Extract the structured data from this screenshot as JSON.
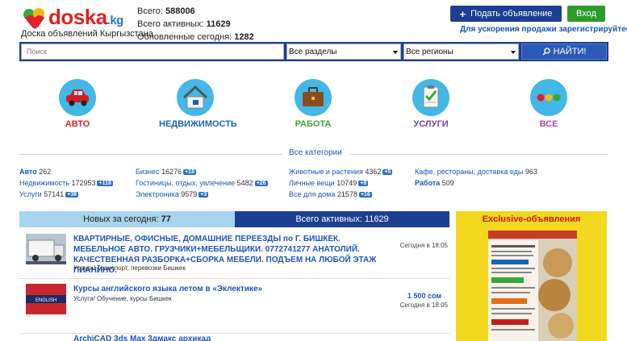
{
  "header": {
    "logo_main": "doska",
    "logo_tld": ".kg",
    "tagline": "Доска объявлений Кыргызстана",
    "stats": [
      {
        "label": "Всего:",
        "value": "588006"
      },
      {
        "label": "Всего активных:",
        "value": "11629"
      },
      {
        "label": "Обновленные сегодня:",
        "value": "1282"
      }
    ],
    "add_button": "Подать объявление",
    "login_button": "Вход",
    "register_link": "Для ускорения продажи зарегистрируйтесь"
  },
  "search": {
    "placeholder": "Поиск",
    "section_select": "Все разделы",
    "region_select": "Все регионы",
    "button": "НАЙТИ!"
  },
  "categories": [
    {
      "label": "АВТО",
      "icon": "car-icon",
      "color": "#e0202a"
    },
    {
      "label": "НЕДВИЖИМОСТЬ",
      "icon": "house-icon",
      "color": "#1c63b8"
    },
    {
      "label": "РАБОТА",
      "icon": "briefcase-icon",
      "color": "#3aa73a"
    },
    {
      "label": "УСЛУГИ",
      "icon": "clipboard-icon",
      "color": "#7b3fa3"
    },
    {
      "label": "ВСЕ",
      "icon": "traffic-dots-icon",
      "color": "#b043b8"
    }
  ],
  "all_categories": "Все категории",
  "subcategories": [
    {
      "name": "Авто",
      "count": "262",
      "badge": "",
      "bold": true
    },
    {
      "name": "Недвижимость",
      "count": "172953",
      "badge": "+118",
      "bold": false
    },
    {
      "name": "Услуги",
      "count": "57141",
      "badge": "+38",
      "bold": false
    },
    {
      "name": "Бизнес",
      "count": "16276",
      "badge": "+18",
      "bold": false
    },
    {
      "name": "Гостиницы, отдых, увлечение",
      "count": "5482",
      "badge": "+26",
      "bold": false
    },
    {
      "name": "Электроника",
      "count": "9579",
      "badge": "+3",
      "bold": false
    },
    {
      "name": "Животные и растения",
      "count": "4362",
      "badge": "+5",
      "bold": false
    },
    {
      "name": "Личные вещи",
      "count": "10749",
      "badge": "+8",
      "bold": false
    },
    {
      "name": "Все для дома",
      "count": "21578",
      "badge": "+16",
      "bold": false
    },
    {
      "name": "Кафе, рестораны, доставка еды",
      "count": "963",
      "badge": "",
      "bold": false
    },
    {
      "name": "Работа",
      "count": "509",
      "badge": "",
      "bold": true
    }
  ],
  "tabs": {
    "new_label": "Новых за сегодня:",
    "new_value": "77",
    "active_label": "Всего активных:",
    "active_value": "11629"
  },
  "listings": [
    {
      "title": "КВАРТИРНЫЕ, ОФИСНЫЕ, ДОМАШНИЕ ПЕРЕЕЗДЫ по Г. БИШКЕК. МЕБЕЛЬНОЕ АВТО. ГРУЗЧИКИ+МЕБЕЛЬЩИКИ. 0772741277 АНАТОЛИЙ. КАЧЕСТВЕННАЯ РАЗБОРКА+СБОРКА МЕБЕЛИ. ПОДЪЕМ НА ЛЮБОЙ ЭТАЖ ПИАНИНО.",
      "meta": "Услуги/ Транспорт, перевозки Бишкек",
      "price": "",
      "date": "Сегодня в 18:05"
    },
    {
      "title": "Курсы английского языка летом в «Эклектике»",
      "meta": "Услуги/ Обучение, курсы Бишкек",
      "price": "1 500 сом",
      "date": "Сегодня в 18:05"
    },
    {
      "title": "ArchiCAD 3ds Max 3дмакс архикад",
      "meta": "",
      "price": "",
      "date": ""
    }
  ],
  "exclusive": {
    "title": "Exclusive-объявления"
  }
}
